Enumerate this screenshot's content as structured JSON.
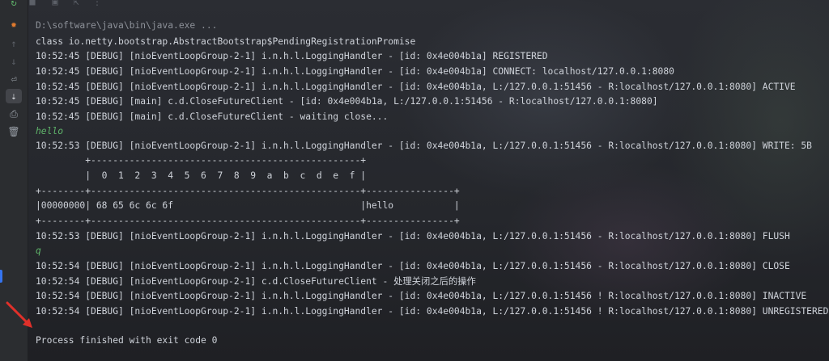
{
  "colors": {
    "text": "#cfd3da",
    "input_text": "#5fb46a",
    "dim_text": "#8d9199",
    "accent": "#3574f0",
    "arrow": "#e0302a"
  },
  "toolstrip": {
    "icons": [
      "rerun-icon",
      "bug-icon",
      "up-arrow-icon",
      "down-arrow-icon",
      "soft-wrap-icon",
      "scroll-to-end-icon",
      "print-icon",
      "trash-icon"
    ]
  },
  "console": {
    "lines": [
      {
        "kind": "cmd",
        "text": "D:\\software\\java\\bin\\java.exe ..."
      },
      {
        "kind": "out",
        "text": "class io.netty.bootstrap.AbstractBootstrap$PendingRegistrationPromise"
      },
      {
        "kind": "out",
        "text": "10:52:45 [DEBUG] [nioEventLoopGroup-2-1] i.n.h.l.LoggingHandler - [id: 0x4e004b1a] REGISTERED"
      },
      {
        "kind": "out",
        "text": "10:52:45 [DEBUG] [nioEventLoopGroup-2-1] i.n.h.l.LoggingHandler - [id: 0x4e004b1a] CONNECT: localhost/127.0.0.1:8080"
      },
      {
        "kind": "out",
        "text": "10:52:45 [DEBUG] [nioEventLoopGroup-2-1] i.n.h.l.LoggingHandler - [id: 0x4e004b1a, L:/127.0.0.1:51456 - R:localhost/127.0.0.1:8080] ACTIVE"
      },
      {
        "kind": "out",
        "text": "10:52:45 [DEBUG] [main] c.d.CloseFutureClient - [id: 0x4e004b1a, L:/127.0.0.1:51456 - R:localhost/127.0.0.1:8080]"
      },
      {
        "kind": "out",
        "text": "10:52:45 [DEBUG] [main] c.d.CloseFutureClient - waiting close..."
      },
      {
        "kind": "input",
        "text": "hello"
      },
      {
        "kind": "out",
        "text": "10:52:53 [DEBUG] [nioEventLoopGroup-2-1] i.n.h.l.LoggingHandler - [id: 0x4e004b1a, L:/127.0.0.1:51456 - R:localhost/127.0.0.1:8080] WRITE: 5B"
      },
      {
        "kind": "out",
        "text": "         +-------------------------------------------------+"
      },
      {
        "kind": "out",
        "text": "         |  0  1  2  3  4  5  6  7  8  9  a  b  c  d  e  f |"
      },
      {
        "kind": "out",
        "text": "+--------+-------------------------------------------------+----------------+"
      },
      {
        "kind": "out",
        "text": "|00000000| 68 65 6c 6c 6f                                  |hello           |"
      },
      {
        "kind": "out",
        "text": "+--------+-------------------------------------------------+----------------+"
      },
      {
        "kind": "out",
        "text": "10:52:53 [DEBUG] [nioEventLoopGroup-2-1] i.n.h.l.LoggingHandler - [id: 0x4e004b1a, L:/127.0.0.1:51456 - R:localhost/127.0.0.1:8080] FLUSH"
      },
      {
        "kind": "input",
        "text": "q"
      },
      {
        "kind": "out",
        "text": "10:52:54 [DEBUG] [nioEventLoopGroup-2-1] i.n.h.l.LoggingHandler - [id: 0x4e004b1a, L:/127.0.0.1:51456 - R:localhost/127.0.0.1:8080] CLOSE"
      },
      {
        "kind": "out",
        "text": "10:52:54 [DEBUG] [nioEventLoopGroup-2-1] c.d.CloseFutureClient - 处理关闭之后的操作"
      },
      {
        "kind": "out",
        "text": "10:52:54 [DEBUG] [nioEventLoopGroup-2-1] i.n.h.l.LoggingHandler - [id: 0x4e004b1a, L:/127.0.0.1:51456 ! R:localhost/127.0.0.1:8080] INACTIVE"
      },
      {
        "kind": "out",
        "text": "10:52:54 [DEBUG] [nioEventLoopGroup-2-1] i.n.h.l.LoggingHandler - [id: 0x4e004b1a, L:/127.0.0.1:51456 ! R:localhost/127.0.0.1:8080] UNREGISTERED"
      },
      {
        "kind": "blank",
        "text": ""
      },
      {
        "kind": "exit",
        "text": "Process finished with exit code 0"
      }
    ]
  }
}
